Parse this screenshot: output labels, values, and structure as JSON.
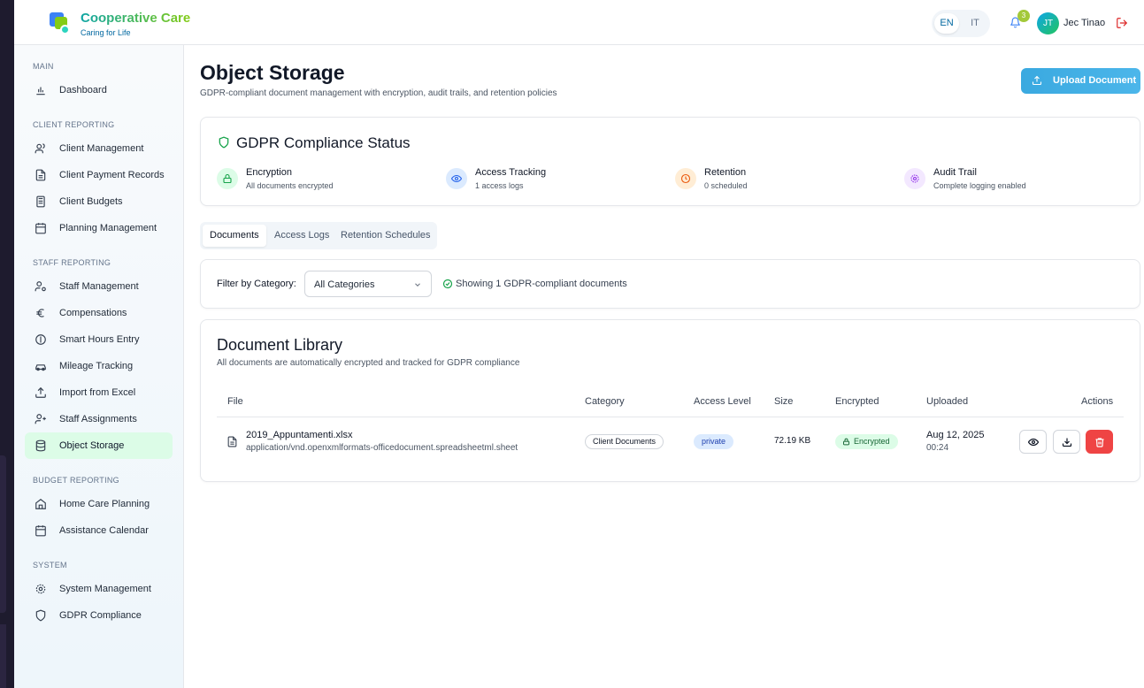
{
  "brand": {
    "name": "Cooperative Care",
    "tagline": "Caring for Life"
  },
  "header": {
    "languages": [
      "EN",
      "IT"
    ],
    "active_language": "EN",
    "notification_count": "3",
    "user_initials": "JT",
    "user_name": "Jec Tinao"
  },
  "sidebar": {
    "sections": [
      {
        "title": "MAIN",
        "items": [
          {
            "label": "Dashboard",
            "icon": "bar-chart-icon"
          }
        ]
      },
      {
        "title": "CLIENT REPORTING",
        "items": [
          {
            "label": "Client Management",
            "icon": "users-icon"
          },
          {
            "label": "Client Payment Records",
            "icon": "document-icon"
          },
          {
            "label": "Client Budgets",
            "icon": "calculator-icon"
          },
          {
            "label": "Planning Management",
            "icon": "calendar-icon"
          }
        ]
      },
      {
        "title": "STAFF REPORTING",
        "items": [
          {
            "label": "Staff Management",
            "icon": "user-cog-icon"
          },
          {
            "label": "Compensations",
            "icon": "euro-icon"
          },
          {
            "label": "Smart Hours Entry",
            "icon": "clock-icon"
          },
          {
            "label": "Mileage Tracking",
            "icon": "car-icon"
          },
          {
            "label": "Import from Excel",
            "icon": "upload-icon"
          },
          {
            "label": "Staff Assignments",
            "icon": "user-plus-icon"
          },
          {
            "label": "Object Storage",
            "icon": "database-icon",
            "active": true
          }
        ]
      },
      {
        "title": "BUDGET REPORTING",
        "items": [
          {
            "label": "Home Care Planning",
            "icon": "home-icon"
          },
          {
            "label": "Assistance Calendar",
            "icon": "calendar-icon"
          }
        ]
      },
      {
        "title": "SYSTEM",
        "items": [
          {
            "label": "System Management",
            "icon": "gear-icon"
          },
          {
            "label": "GDPR Compliance",
            "icon": "shield-icon"
          }
        ]
      }
    ]
  },
  "page": {
    "title": "Object Storage",
    "subtitle": "GDPR-compliant document management with encryption, audit trails, and retention policies",
    "upload_label": "Upload Document"
  },
  "gdpr": {
    "title": "GDPR Compliance Status",
    "stats": [
      {
        "title": "Encryption",
        "desc": "All documents encrypted",
        "color": "#16a34a",
        "bg": "#dcfce7"
      },
      {
        "title": "Access Tracking",
        "desc": "1 access logs",
        "color": "#2563eb",
        "bg": "#dbeafe"
      },
      {
        "title": "Retention",
        "desc": "0 scheduled",
        "color": "#ea580c",
        "bg": "#ffedd5"
      },
      {
        "title": "Audit Trail",
        "desc": "Complete logging enabled",
        "color": "#9333ea",
        "bg": "#f3e8ff"
      }
    ]
  },
  "tabs": [
    "Documents",
    "Access Logs",
    "Retention Schedules"
  ],
  "filter": {
    "label": "Filter by Category:",
    "selected": "All Categories",
    "showing": "Showing 1 GDPR-compliant documents"
  },
  "library": {
    "title": "Document Library",
    "subtitle": "All documents are automatically encrypted and tracked for GDPR compliance",
    "columns": [
      "File",
      "Category",
      "Access Level",
      "Size",
      "Encrypted",
      "Uploaded",
      "Actions"
    ],
    "rows": [
      {
        "file_name": "2019_Appuntamenti.xlsx",
        "mime": "application/vnd.openxmlformats-officedocument.spreadsheetml.sheet",
        "category": "Client Documents",
        "access": "private",
        "size": "72.19 KB",
        "encrypted": "Encrypted",
        "date": "Aug 12, 2025",
        "time": "00:24"
      }
    ]
  },
  "colors": {
    "accent": "#3aa9e0",
    "active_nav": "#dcfce7",
    "danger": "#ef4444"
  }
}
